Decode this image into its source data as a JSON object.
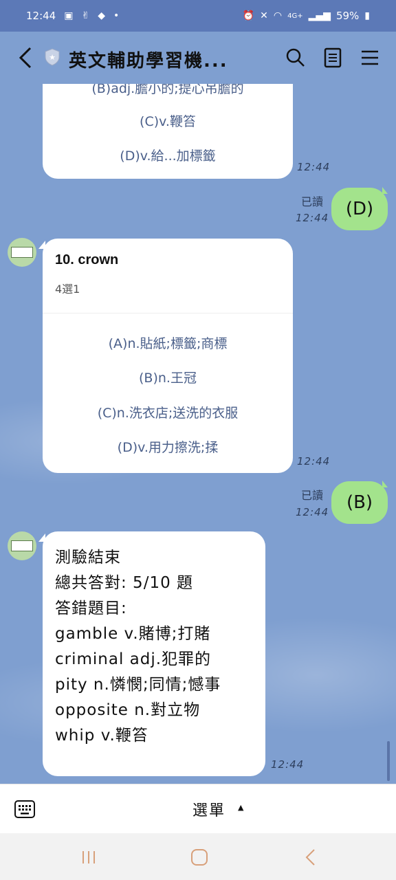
{
  "status_bar": {
    "time": "12:44",
    "network": "4G+",
    "battery": "59%"
  },
  "header": {
    "title": "英文輔助學習機..."
  },
  "messages": {
    "prev_options": [
      "(B)adj.膽小的;提心吊膽的",
      "(C)v.鞭笞",
      "(D)v.給...加標籤"
    ],
    "prev_time": "12:44",
    "reply1_read": "已讀",
    "reply1_time": "12:44",
    "reply1_text": "(D)",
    "question": {
      "title": "10. crown",
      "subtitle": "4選1",
      "options": [
        "(A)n.貼紙;標籤;商標",
        "(B)n.王冠",
        "(C)n.洗衣店;送洗的衣服",
        "(D)v.用力擦洗;揉"
      ],
      "time": "12:44"
    },
    "reply2_read": "已讀",
    "reply2_time": "12:44",
    "reply2_text": "(B)",
    "result": {
      "lines": [
        "測驗結束",
        "總共答對: 5/10 題",
        "答錯題目:",
        "gamble v.賭博;打賭",
        "criminal adj.犯罪的",
        "pity n.憐憫;同情;憾事",
        "opposite n.對立物",
        "whip v.鞭笞"
      ],
      "time": "12:44"
    }
  },
  "input_bar": {
    "menu_label": "選單"
  },
  "colors": {
    "chat_bg": "#7f9fd0",
    "status_bg": "#5c79b7",
    "green_bubble": "#a3e38c",
    "option_text": "#4a5f8a"
  }
}
